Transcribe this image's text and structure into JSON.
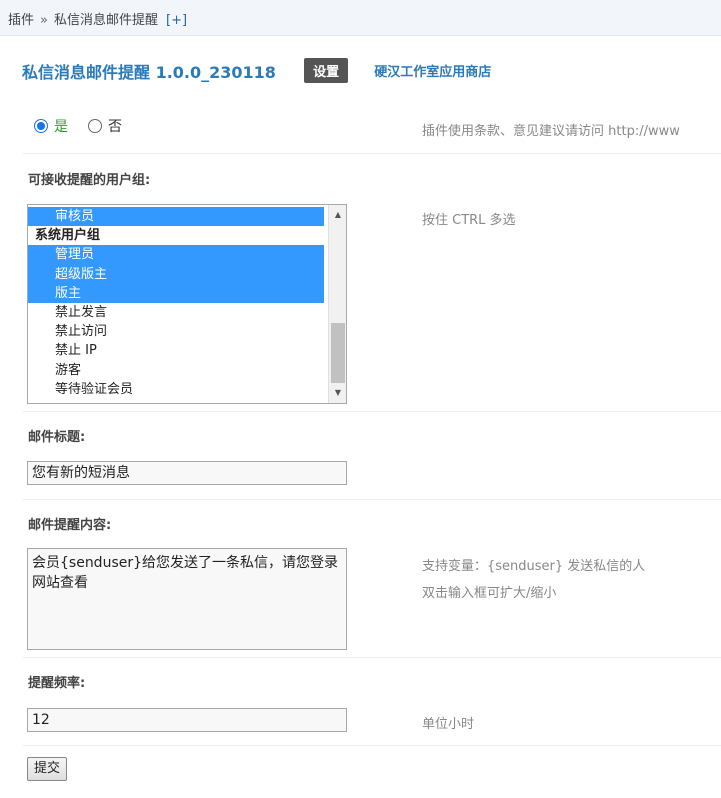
{
  "breadcrumb": {
    "root": "插件",
    "separator": "»",
    "current": "私信消息邮件提醒",
    "add_label": "[+]"
  },
  "header": {
    "title": "私信消息邮件提醒 1.0.0_230118",
    "settings_label": "设置",
    "store_label": "硬汉工作室应用商店"
  },
  "enable": {
    "yes_label": "是",
    "no_label": "否",
    "selected": "是",
    "hint": "插件使用条款、意见建议请访问 http://www"
  },
  "groups": {
    "label": "可接收提醒的用户组:",
    "hint": "按住 CTRL 多选",
    "items": [
      {
        "label": "审核员",
        "selected": true,
        "group": false
      },
      {
        "label": "系统用户组",
        "selected": false,
        "group": true
      },
      {
        "label": "管理员",
        "selected": true,
        "group": false
      },
      {
        "label": "超级版主",
        "selected": true,
        "group": false
      },
      {
        "label": "版主",
        "selected": true,
        "group": false
      },
      {
        "label": "禁止发言",
        "selected": false,
        "group": false
      },
      {
        "label": "禁止访问",
        "selected": false,
        "group": false
      },
      {
        "label": "禁止 IP",
        "selected": false,
        "group": false
      },
      {
        "label": "游客",
        "selected": false,
        "group": false
      },
      {
        "label": "等待验证会员",
        "selected": false,
        "group": false
      }
    ]
  },
  "subject": {
    "label": "邮件标题:",
    "value": "您有新的短消息"
  },
  "content": {
    "label": "邮件提醒内容:",
    "value": "会员{senduser}给您发送了一条私信，请您登录网站查看",
    "hint_1": "支持变量：{senduser} 发送私信的人",
    "hint_2": "双击输入框可扩大/缩小"
  },
  "frequency": {
    "label": "提醒频率:",
    "value": "12",
    "hint": "单位小时"
  },
  "submit_label": "提交",
  "colors": {
    "accent": "#2b7bb9",
    "selection": "#3399ff",
    "yes_green": "#2ca02c"
  }
}
